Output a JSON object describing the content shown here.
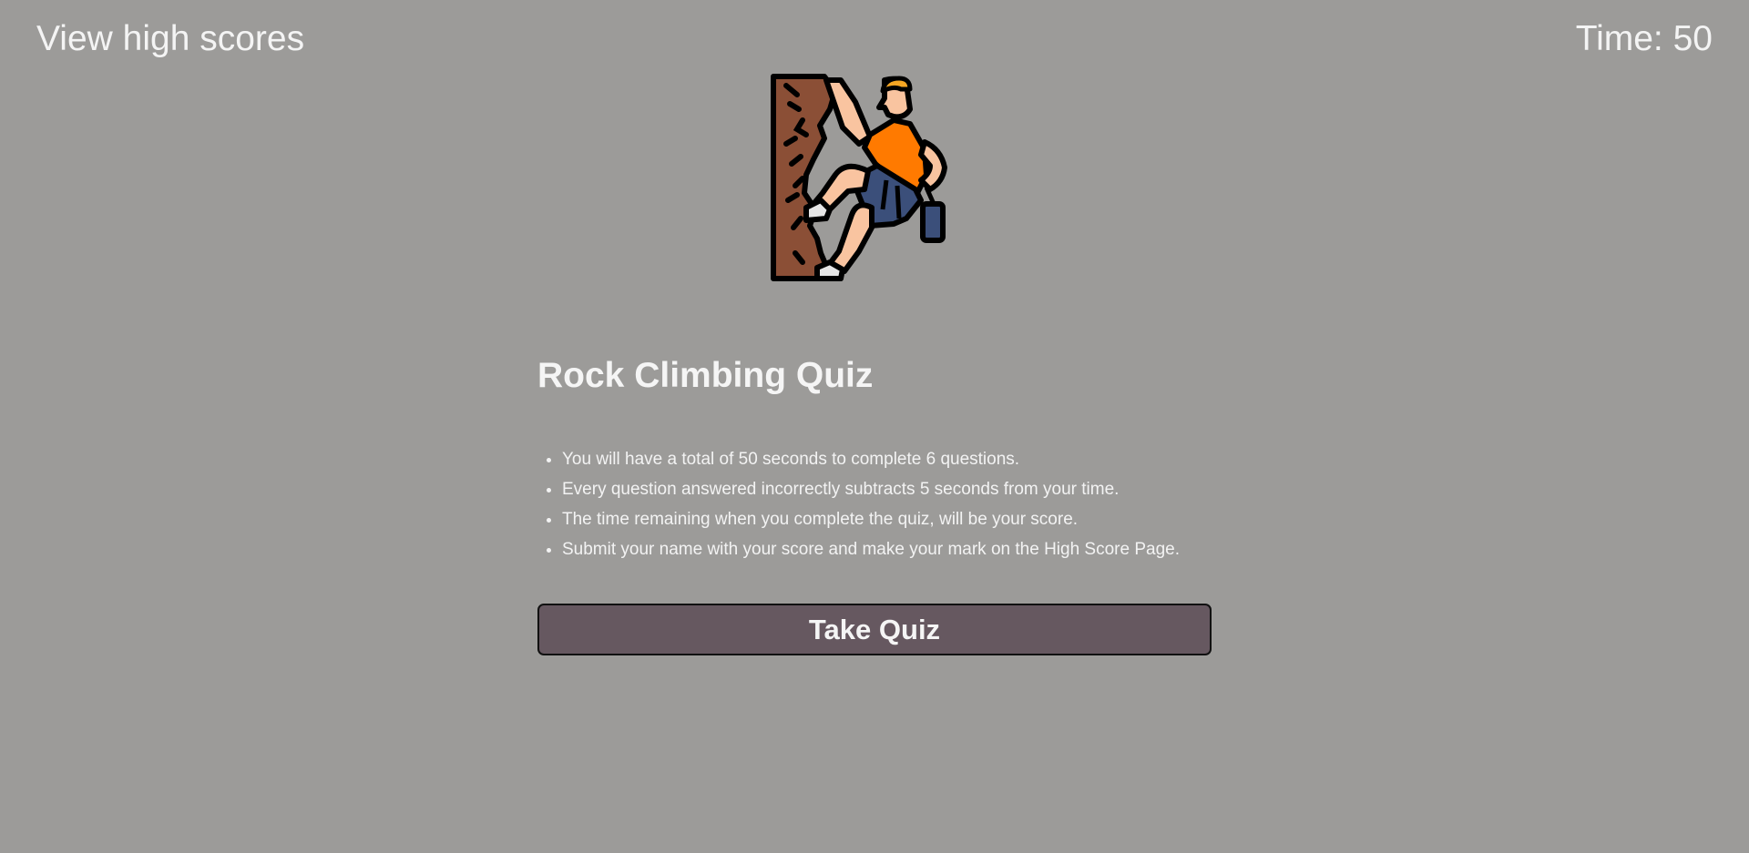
{
  "header": {
    "high_scores_link": "View high scores",
    "timer_label": "Time: ",
    "timer_value": "50"
  },
  "hero": {
    "icon": "rock-climber-icon"
  },
  "quiz": {
    "title": "Rock Climbing Quiz",
    "rules": [
      "You will have a total of 50 seconds to complete 6 questions.",
      "Every question answered incorrectly subtracts 5 seconds from your time.",
      "The time remaining when you complete the quiz, will be your score.",
      "Submit your name with your score and make your mark on the High Score Page."
    ],
    "start_button": "Take Quiz"
  },
  "colors": {
    "background": "#9c9b99",
    "button": "#665860",
    "text": "#f2f2f2"
  }
}
